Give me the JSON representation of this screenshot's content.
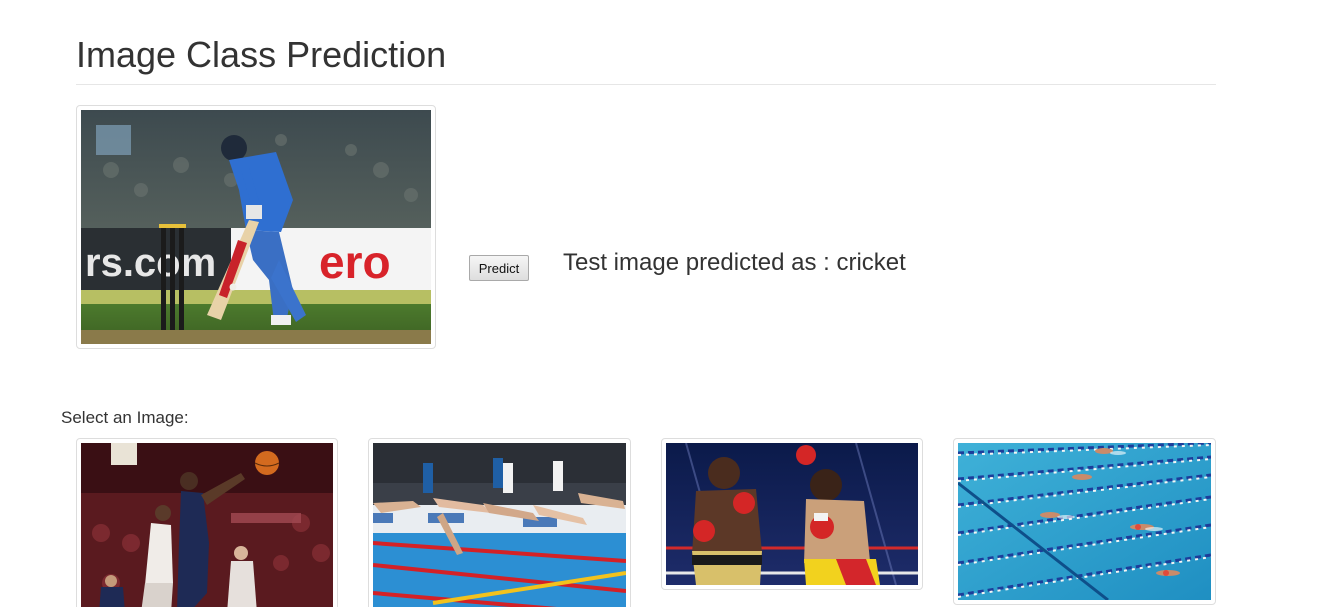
{
  "header": {
    "title": "Image Class Prediction"
  },
  "test_image": {
    "alt": "cricket"
  },
  "predict": {
    "button_label": "Predict",
    "result_prefix": "Test image predicted as : ",
    "result_class": "cricket"
  },
  "gallery": {
    "label": "Select an Image:",
    "images": [
      {
        "alt": "basketball"
      },
      {
        "alt": "swimming"
      },
      {
        "alt": "boxing"
      },
      {
        "alt": "swimming"
      }
    ]
  }
}
